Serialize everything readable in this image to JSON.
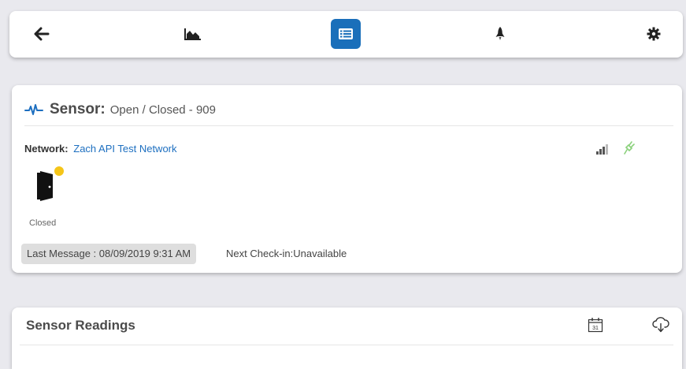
{
  "toolbar": {
    "items": [
      {
        "name": "back",
        "icon": "arrow-left-icon"
      },
      {
        "name": "chart",
        "icon": "area-chart-icon"
      },
      {
        "name": "details",
        "icon": "list-icon",
        "active": true
      },
      {
        "name": "rocket",
        "icon": "rocket-icon"
      },
      {
        "name": "settings",
        "icon": "gear-icon"
      }
    ],
    "active_color": "#1a6fba"
  },
  "sensor": {
    "icon": "heartbeat-icon",
    "title_label": "Sensor:",
    "name": "Open / Closed - 909",
    "network_label": "Network:",
    "network_name": "Zach API Test Network",
    "status": "Closed",
    "status_dot_color": "#f5c518",
    "last_message": "Last Message : 08/09/2019 9:31 AM",
    "next_checkin": "Next Check-in:Unavailable",
    "signal_icon": "signal-icon",
    "power_icon": "plug-icon",
    "power_color": "#8bd17c"
  },
  "readings": {
    "title": "Sensor Readings",
    "calendar_icon": "calendar-icon",
    "calendar_day": "31",
    "download_icon": "cloud-download-icon"
  }
}
